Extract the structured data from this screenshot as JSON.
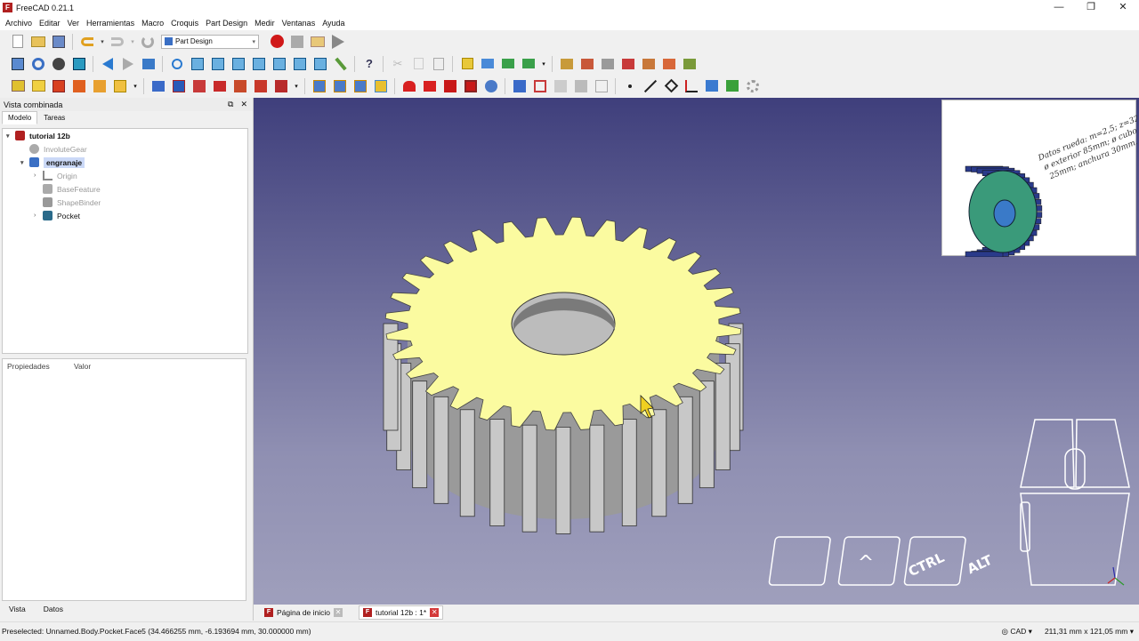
{
  "window": {
    "title": "FreeCAD 0.21.1",
    "app_icon_glyph": "F",
    "minimize": "—",
    "maximize": "❐",
    "close": "✕"
  },
  "menu": [
    "Archivo",
    "Editar",
    "Ver",
    "Herramientas",
    "Macro",
    "Croquis",
    "Part Design",
    "Medir",
    "Ventanas",
    "Ayuda"
  ],
  "workbench": {
    "selected": "Part Design"
  },
  "combo_view": {
    "title": "Vista combinada",
    "float_btn": "⧉",
    "close_btn": "✕",
    "tabs": [
      "Modelo",
      "Tareas"
    ],
    "tree": [
      {
        "label": "tutorial 12b",
        "icon": "document-icon",
        "arrow": "▾"
      },
      {
        "label": "InvoluteGear",
        "icon": "gear-icon",
        "arrow": ""
      },
      {
        "label": "engranaje",
        "icon": "body-icon",
        "arrow": "▾"
      },
      {
        "label": "Origin",
        "icon": "origin-icon",
        "arrow": "›"
      },
      {
        "label": "BaseFeature",
        "icon": "feature-icon",
        "arrow": ""
      },
      {
        "label": "ShapeBinder",
        "icon": "shapebinder-icon",
        "arrow": ""
      },
      {
        "label": "Pocket",
        "icon": "pocket-icon",
        "arrow": "›"
      }
    ],
    "properties": {
      "col1": "Propiedades",
      "col2": "Valor"
    },
    "bottom_tabs": [
      "Vista",
      "Datos"
    ]
  },
  "inset_note": [
    "Datos rueda: m=2,5; z=32;",
    "ø exterior 85mm; ø cubo",
    "25mm; anchura 30mm."
  ],
  "nav_keys": [
    "^",
    "CTRL",
    "ALT"
  ],
  "doc_tabs": [
    {
      "label": "Página de inicio",
      "active": false,
      "close": "✕"
    },
    {
      "label": "tutorial 12b : 1*",
      "active": true,
      "close": "✕"
    }
  ],
  "status": {
    "preselected": "Preselected: Unnamed.Body.Pocket.Face5 (34.466255 mm, -6.193694 mm, 30.000000 mm)",
    "nav_style": "CAD",
    "dimensions": "211,31 mm x 121,05 mm"
  },
  "colors": {
    "accent": "#3a6fc4",
    "gear_face": "#fbfba0",
    "gear_side": "#c8c8c8",
    "viewport_top": "#3f3f7c",
    "viewport_bottom": "#9f9fbc"
  }
}
